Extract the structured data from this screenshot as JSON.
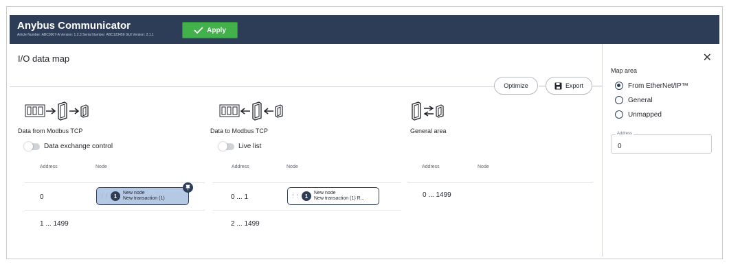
{
  "app": {
    "title": "Anybus Communicator",
    "subtitle": "Article Number: ABC3007-A Version: 1.2.3 Serial Number: ABC123456 GUI Version: 2.1.1",
    "apply_label": "Apply"
  },
  "page": {
    "title": "I/O data map",
    "optimize_label": "Optimize",
    "export_label": "Export"
  },
  "columns": [
    {
      "title": "Data from Modbus TCP",
      "toggle_label": "Data exchange control",
      "address_header": "Address",
      "node_header": "Node",
      "rows": [
        {
          "address": "0",
          "node_name": "New node",
          "node_detail": "New transaction (1)",
          "node_number": "1"
        },
        {
          "address": "1 ... 1499"
        }
      ]
    },
    {
      "title": "Data to Modbus TCP",
      "toggle_label": "Live list",
      "address_header": "Address",
      "node_header": "Node",
      "rows": [
        {
          "address": "0 ... 1",
          "node_name": "New node",
          "node_detail": "New transaction (1) R...",
          "node_number": "1"
        },
        {
          "address": "2 ... 1499"
        }
      ]
    },
    {
      "title": "General area",
      "address_header": "Address",
      "node_header": "Node",
      "rows": [
        {
          "address": "0 ... 1499"
        }
      ]
    }
  ],
  "panel": {
    "label": "Map area",
    "options": [
      "From EtherNet/IP™",
      "General",
      "Unmapped"
    ],
    "selected": "From EtherNet/IP™",
    "address_label": "Address",
    "address_value": "0"
  },
  "colors": {
    "header_bg": "#2e3d57",
    "apply_green": "#43b14b",
    "chip_selected": "#b5c8e4"
  }
}
